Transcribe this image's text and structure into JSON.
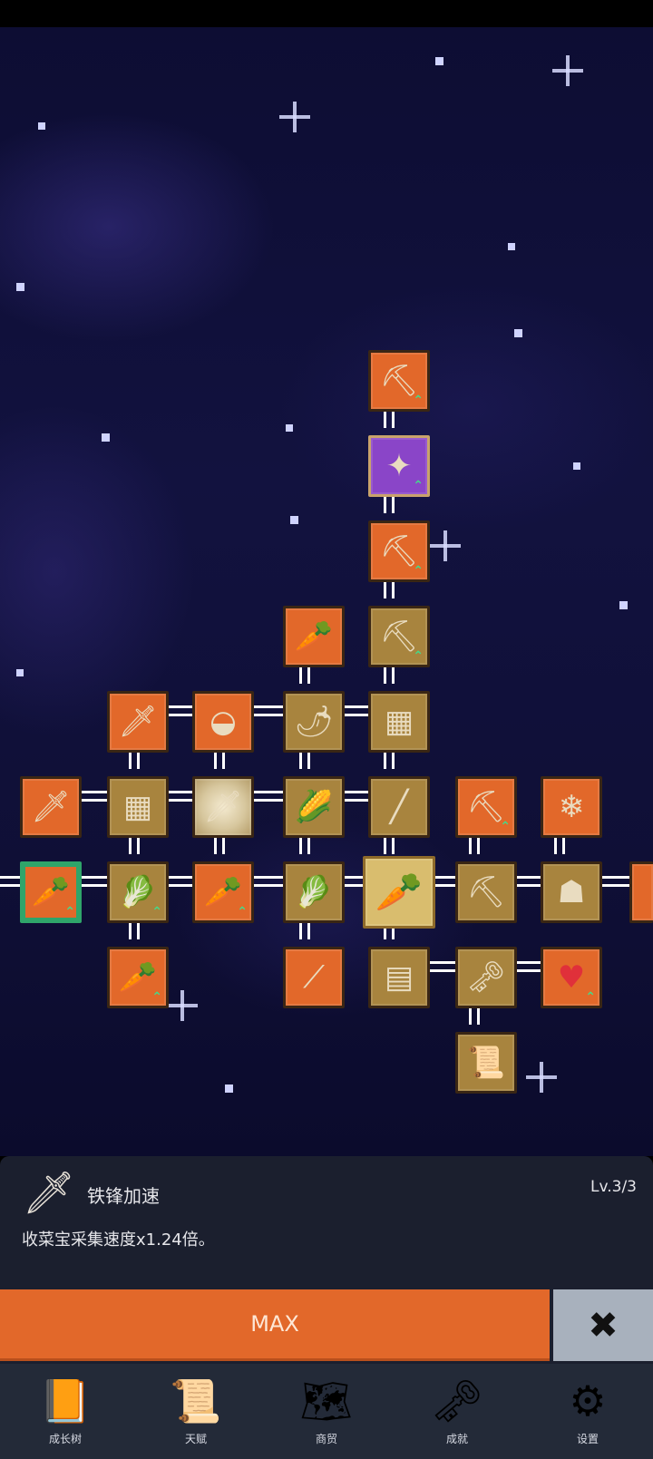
{
  "info": {
    "skill_name": "铁锋加速",
    "level": "Lv.3/3",
    "description": "收菜宝采集速度x1.24倍。",
    "icon": "sword-icon"
  },
  "actions": {
    "max_label": "MAX",
    "close_icon": "close-icon"
  },
  "nav": [
    {
      "label": "成长树",
      "icon": "book-icon"
    },
    {
      "label": "天赋",
      "icon": "scroll-icon"
    },
    {
      "label": "商贸",
      "icon": "map-icon"
    },
    {
      "label": "成就",
      "icon": "key-icon"
    },
    {
      "label": "设置",
      "icon": "gear-icon"
    }
  ],
  "tree_nodes": [
    {
      "id": "shovel-top",
      "icon": "shovel-icon",
      "style": "orange",
      "upgrade": true
    },
    {
      "id": "shovel-purple",
      "icon": "magic-shovel-icon",
      "style": "purple",
      "upgrade": true
    },
    {
      "id": "shovel-3",
      "icon": "shovel-icon",
      "style": "orange",
      "upgrade": true
    },
    {
      "id": "shovel-4",
      "icon": "shovel-icon",
      "style": "gold",
      "upgrade": true
    },
    {
      "id": "radish",
      "icon": "radish-icon",
      "style": "orange",
      "upgrade": false
    },
    {
      "id": "golden-sword",
      "icon": "golden-sword-icon",
      "style": "orange",
      "upgrade": false
    },
    {
      "id": "bowl",
      "icon": "bowl-icon",
      "style": "orange",
      "upgrade": false
    },
    {
      "id": "chili",
      "icon": "chili-icon",
      "style": "gold",
      "upgrade": false
    },
    {
      "id": "backpack-top",
      "icon": "backpack-icon",
      "style": "gold",
      "upgrade": false
    },
    {
      "id": "sword-left",
      "icon": "sword-icon",
      "style": "orange",
      "upgrade": false
    },
    {
      "id": "backpack-mid",
      "icon": "backpack-icon",
      "style": "gold",
      "upgrade": false
    },
    {
      "id": "sword-shine",
      "icon": "sword-icon",
      "style": "shine",
      "upgrade": false
    },
    {
      "id": "corn",
      "icon": "corn-icon",
      "style": "gold",
      "upgrade": false
    },
    {
      "id": "staff",
      "icon": "staff-icon",
      "style": "gold",
      "upgrade": false
    },
    {
      "id": "pickaxe-top",
      "icon": "pickaxe-icon",
      "style": "orange",
      "upgrade": true
    },
    {
      "id": "crystal",
      "icon": "crystal-icon",
      "style": "orange",
      "upgrade": false
    },
    {
      "id": "carrot-green",
      "icon": "carrot-icon",
      "style": "green",
      "upgrade": true
    },
    {
      "id": "cabbage-1",
      "icon": "cabbage-icon",
      "style": "gold",
      "upgrade": true
    },
    {
      "id": "carrot-2",
      "icon": "carrot-icon",
      "style": "orange",
      "upgrade": true
    },
    {
      "id": "cabbage-2",
      "icon": "cabbage-icon",
      "style": "gold",
      "upgrade": false
    },
    {
      "id": "carrot-selected",
      "icon": "carrot-icon",
      "style": "selected",
      "upgrade": false
    },
    {
      "id": "pickaxe-2",
      "icon": "pickaxe-icon",
      "style": "gold",
      "upgrade": false
    },
    {
      "id": "statue",
      "icon": "statue-icon",
      "style": "gold",
      "upgrade": false
    },
    {
      "id": "statue-edge",
      "icon": "statue-icon",
      "style": "orange",
      "upgrade": false
    },
    {
      "id": "carrot-bottom",
      "icon": "carrot-icon",
      "style": "orange",
      "upgrade": true
    },
    {
      "id": "parsnip",
      "icon": "parsnip-icon",
      "style": "orange",
      "upgrade": false
    },
    {
      "id": "treasure-map",
      "icon": "map-icon",
      "style": "gold",
      "upgrade": false
    },
    {
      "id": "golden-key",
      "icon": "key-icon",
      "style": "gold",
      "upgrade": false
    },
    {
      "id": "heart",
      "icon": "heart-icon",
      "style": "orange",
      "upgrade": true
    },
    {
      "id": "scroll",
      "icon": "scroll-icon",
      "style": "gold",
      "upgrade": false
    }
  ]
}
